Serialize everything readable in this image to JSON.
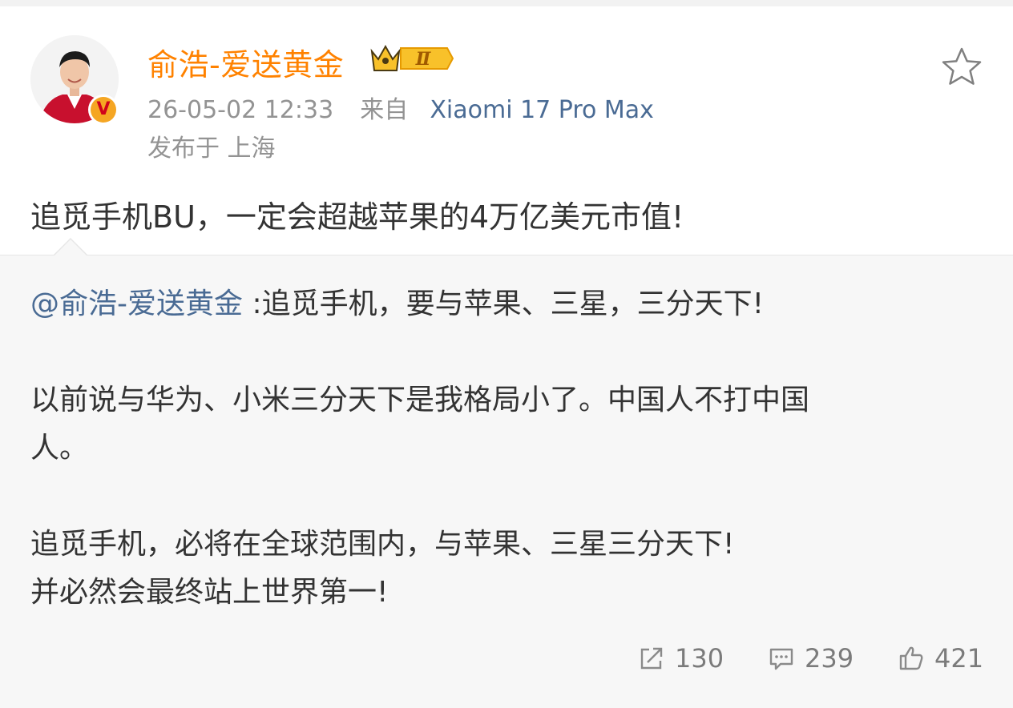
{
  "header": {
    "username": "俞浩-爱送黄金",
    "vip_level": "Ⅱ",
    "verified_mark": "V",
    "timestamp": "26-05-02 12:33",
    "from_label": "来自",
    "device": "Xiaomi 17 Pro Max",
    "location": "发布于 上海"
  },
  "post": {
    "text": "追觅手机BU，一定会超越苹果的4万亿美元市值!"
  },
  "repost": {
    "mention": "@俞浩-爱送黄金",
    "line1_rest": " :追觅手机，要与苹果、三星，三分天下!",
    "line2": "以前说与华为、小米三分天下是我格局小了。中国人不打中国",
    "line3": "人。",
    "line4": "追觅手机，必将在全球范围内，与苹果、三星三分天下!",
    "line5": "并必然会最终站上世界第一!",
    "stats": {
      "reposts": "130",
      "comments": "239",
      "likes": "421"
    }
  },
  "icons": {
    "favorite": "star-outline-icon",
    "repost": "share-icon",
    "comment": "comment-icon",
    "like": "thumbs-up-icon"
  },
  "colors": {
    "username": "#ff8200",
    "link": "#4a6b94",
    "meta": "#939393",
    "repost_bg": "#f7f7f7"
  }
}
